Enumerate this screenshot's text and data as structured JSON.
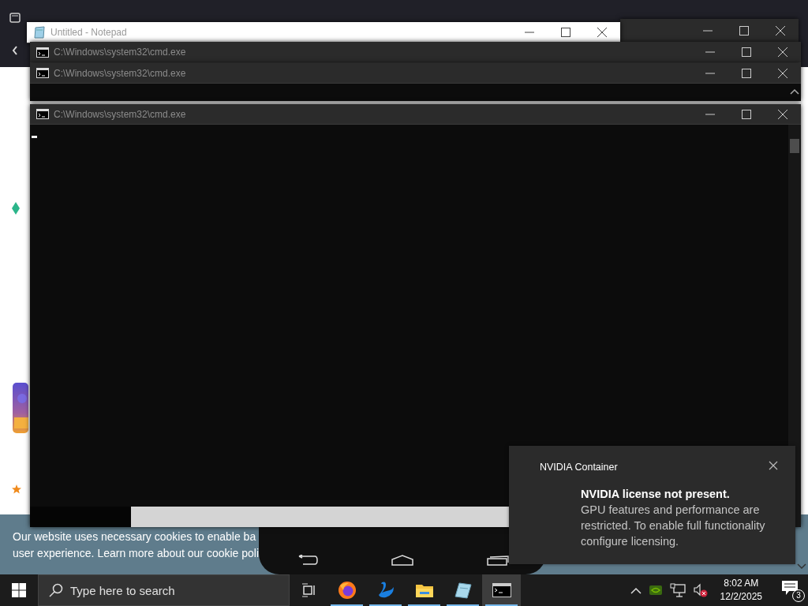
{
  "background_page": {
    "cookie_banner": {
      "lines": [
        "Our website uses necessary cookies to enable ba",
        "user experience. Learn more about our cookie poli"
      ]
    }
  },
  "windows": [
    {
      "kind": "blank"
    },
    {
      "kind": "notepad",
      "title": "Untitled - Notepad"
    },
    {
      "kind": "cmd",
      "title": "C:\\Windows\\system32\\cmd.exe"
    },
    {
      "kind": "cmd",
      "title": "C:\\Windows\\system32\\cmd.exe"
    },
    {
      "kind": "cmd",
      "title": "C:\\Windows\\system32\\cmd.exe"
    }
  ],
  "notification": {
    "app": "NVIDIA Container",
    "title": "NVIDIA license not present.",
    "body": "GPU features and performance are restricted. To enable full functionality configure licensing."
  },
  "taskbar": {
    "search": {
      "placeholder": "Type here to search"
    },
    "apps": [
      {
        "kind": "firefox",
        "running": true,
        "selected": false
      },
      {
        "kind": "swan",
        "running": true,
        "selected": false
      },
      {
        "kind": "folder",
        "running": true,
        "selected": false
      },
      {
        "kind": "notepad",
        "running": true,
        "selected": false
      },
      {
        "kind": "cmd",
        "running": true,
        "selected": true
      }
    ],
    "clock": {
      "time": "8:02 AM",
      "date": "12/2/2025"
    },
    "notification_count": "3"
  }
}
